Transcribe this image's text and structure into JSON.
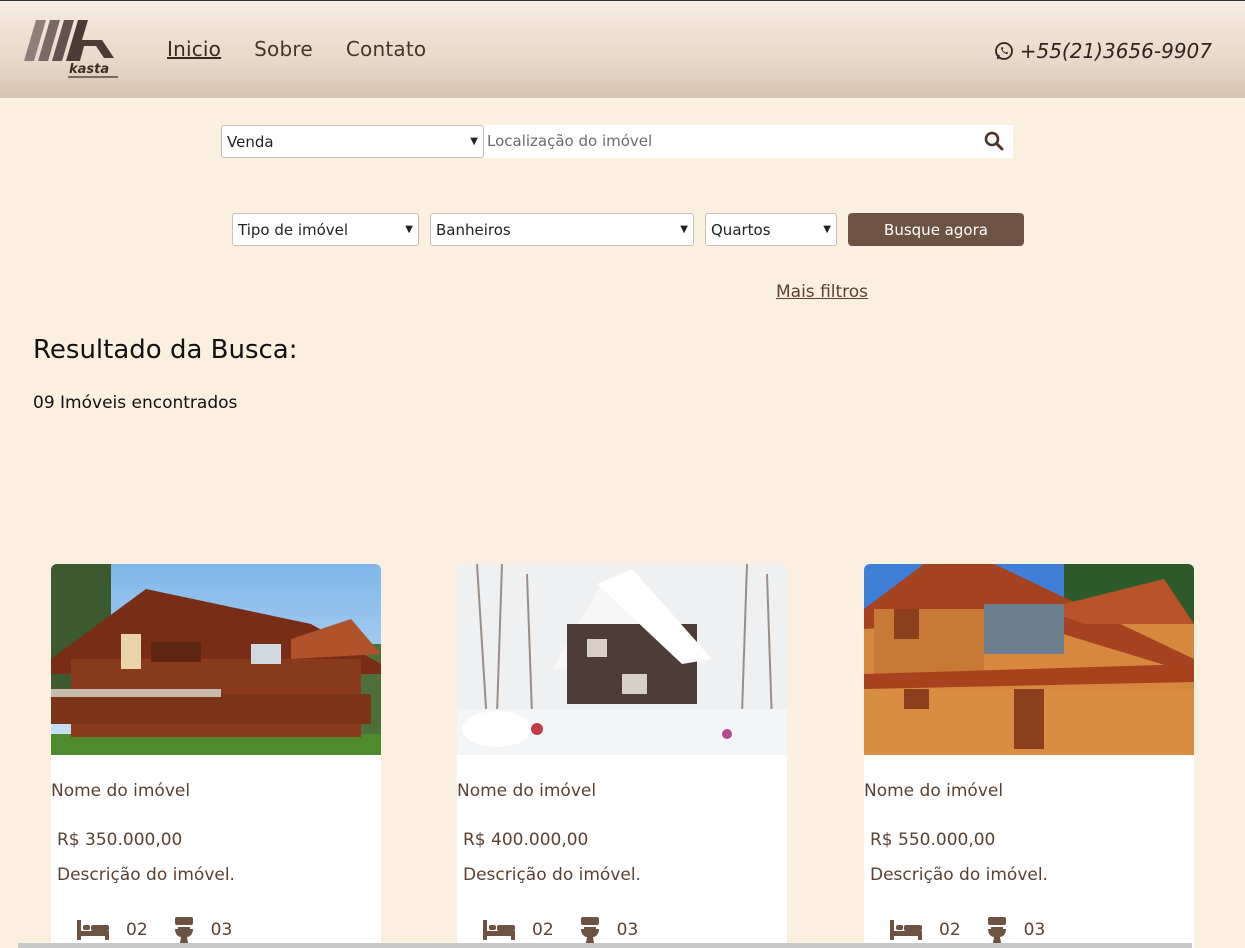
{
  "header": {
    "nav": [
      "Inicio",
      "Sobre",
      "Contato"
    ],
    "phone": "+55(21)3656-9907",
    "logo_text": "kasta"
  },
  "search": {
    "mode_value": "Venda",
    "location_placeholder": "Localização do imóvel",
    "type_value": "Tipo de imóvel",
    "bath_value": "Banheiros",
    "rooms_value": "Quartos",
    "button_label": "Busque agora",
    "more_filters": "Mais filtros"
  },
  "results": {
    "title": "Resultado da Busca:",
    "count": "09 Imóveis encontrados"
  },
  "cards": [
    {
      "name": "Nome do imóvel",
      "price": "R$ 350.000,00",
      "desc": "Descrição do imóvel.",
      "beds": "02",
      "baths": "03"
    },
    {
      "name": "Nome do imóvel",
      "price": "R$ 400.000,00",
      "desc": "Descrição do imóvel.",
      "beds": "02",
      "baths": "03"
    },
    {
      "name": "Nome do imóvel",
      "price": "R$ 550.000,00",
      "desc": "Descrição do imóvel.",
      "beds": "02",
      "baths": "03"
    }
  ],
  "colors": {
    "accent": "#6e5242",
    "background": "#fbefe0",
    "text": "#5a4232"
  }
}
